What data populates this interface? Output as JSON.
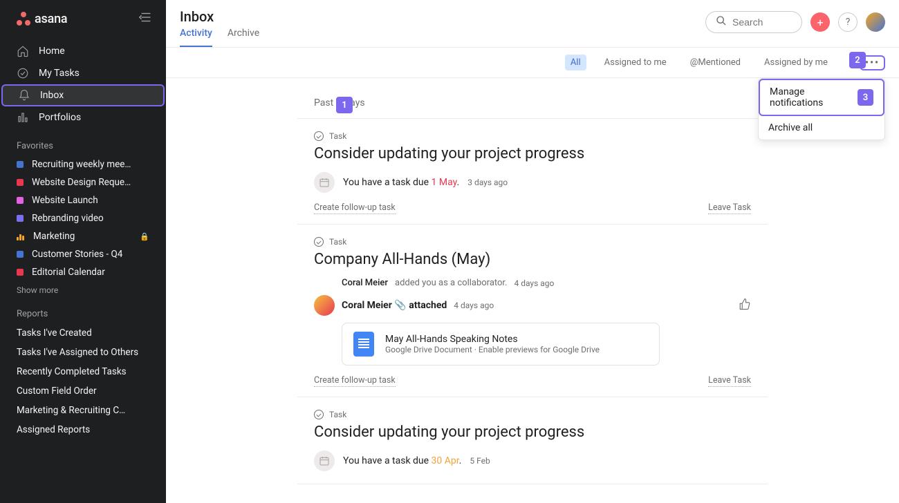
{
  "brand": "asana",
  "sidebar": {
    "nav": [
      {
        "label": "Home"
      },
      {
        "label": "My Tasks"
      },
      {
        "label": "Inbox"
      },
      {
        "label": "Portfolios"
      }
    ],
    "favorites_title": "Favorites",
    "favorites": [
      {
        "label": "Recruiting weekly mee…",
        "color": "#4573d2"
      },
      {
        "label": "Website Design Reque…",
        "color": "#e8384f"
      },
      {
        "label": "Website Launch",
        "color": "#e362e3"
      },
      {
        "label": "Rebranding video",
        "color": "#7a6ff0"
      },
      {
        "label": "Marketing",
        "icon": "bars",
        "locked": true
      },
      {
        "label": "Customer Stories - Q4",
        "color": "#4573d2"
      },
      {
        "label": "Editorial Calendar",
        "color": "#e8384f"
      }
    ],
    "show_more": "Show more",
    "reports_title": "Reports",
    "reports": [
      "Tasks I've Created",
      "Tasks I've Assigned to Others",
      "Recently Completed Tasks",
      "Custom Field Order",
      "Marketing & Recruiting C…",
      "Assigned Reports"
    ]
  },
  "header": {
    "title": "Inbox",
    "tabs": [
      {
        "label": "Activity",
        "active": true
      },
      {
        "label": "Archive",
        "active": false
      }
    ],
    "search_placeholder": "Search"
  },
  "filters": [
    {
      "label": "All",
      "active": true
    },
    {
      "label": "Assigned to me"
    },
    {
      "label": "@Mentioned"
    },
    {
      "label": "Assigned by me"
    }
  ],
  "dropdown": {
    "items": [
      {
        "label": "Manage notifications",
        "badge": "3"
      },
      {
        "label": "Archive all"
      }
    ]
  },
  "callouts": {
    "c1": "1",
    "c2": "2",
    "c3": "3"
  },
  "feed": {
    "section": "Past 7 Days",
    "items": [
      {
        "type_label": "Task",
        "title": "Consider updating your project progress",
        "due_prefix": "You have a task due ",
        "due_date": "1 May",
        "meta_time": "3 days ago",
        "followup": "Create follow-up task",
        "leave": "Leave Task"
      },
      {
        "type_label": "Task",
        "title": "Company All-Hands (May)",
        "collab_name": "Coral Meier",
        "collab_text": " added you as a collaborator.",
        "collab_time": "4 days ago",
        "attach_name": "Coral Meier",
        "attach_action": "attached",
        "attach_time": "4 days ago",
        "attachment_title": "May All-Hands Speaking Notes",
        "attachment_sub": "Google Drive Document · Enable previews for Google Drive",
        "followup": "Create follow-up task",
        "leave": "Leave Task"
      },
      {
        "type_label": "Task",
        "title": "Consider updating your project progress",
        "due_prefix": "You have a task due ",
        "due_date": "30 Apr",
        "due_class": "orange",
        "meta_time": "5 Feb"
      }
    ]
  }
}
